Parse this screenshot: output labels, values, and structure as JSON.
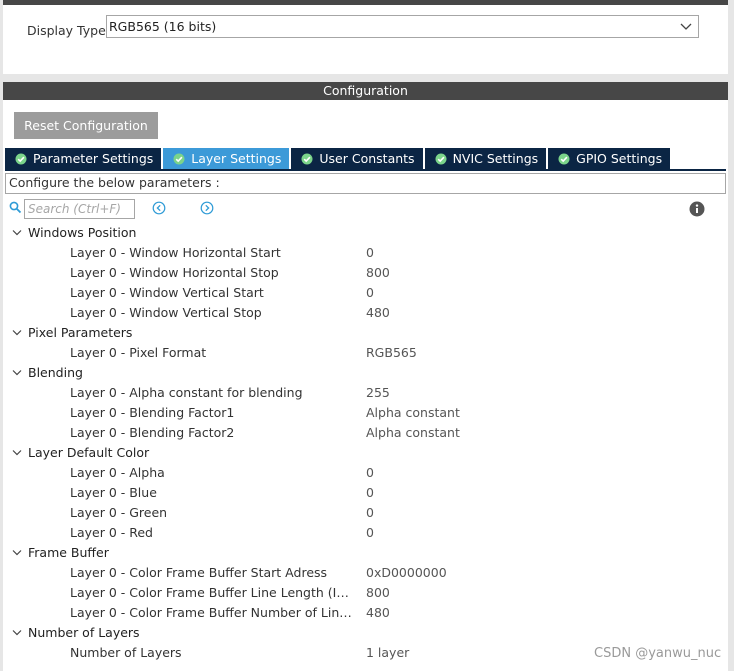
{
  "display": {
    "label": "Display Type",
    "value": "RGB565 (16 bits)"
  },
  "configuration": {
    "header": "Configuration",
    "reset_label": "Reset Configuration",
    "tabs": [
      {
        "label": "Parameter Settings",
        "active": false
      },
      {
        "label": "Layer Settings",
        "active": true
      },
      {
        "label": "User Constants",
        "active": false
      },
      {
        "label": "NVIC Settings",
        "active": false
      },
      {
        "label": "GPIO Settings",
        "active": false
      }
    ],
    "hint": "Configure the below parameters :",
    "search_placeholder": "Search (Ctrl+F)"
  },
  "groups": [
    {
      "label": "Windows Position",
      "params": [
        {
          "name": "Layer 0 - Window Horizontal Start",
          "value": "0"
        },
        {
          "name": "Layer 0 - Window Horizontal Stop",
          "value": "800"
        },
        {
          "name": "Layer 0 - Window Vertical Start",
          "value": "0"
        },
        {
          "name": "Layer 0 - Window Vertical Stop",
          "value": "480"
        }
      ]
    },
    {
      "label": "Pixel Parameters",
      "params": [
        {
          "name": "Layer 0 - Pixel Format",
          "value": "RGB565"
        }
      ]
    },
    {
      "label": "Blending",
      "params": [
        {
          "name": "Layer 0 - Alpha constant for blending",
          "value": "255"
        },
        {
          "name": "Layer 0 - Blending Factor1",
          "value": "Alpha constant"
        },
        {
          "name": "Layer 0 - Blending Factor2",
          "value": "Alpha constant"
        }
      ]
    },
    {
      "label": "Layer Default Color",
      "params": [
        {
          "name": "Layer 0 - Alpha",
          "value": "0"
        },
        {
          "name": "Layer 0 - Blue",
          "value": "0"
        },
        {
          "name": "Layer 0 - Green",
          "value": "0"
        },
        {
          "name": "Layer 0 - Red",
          "value": "0"
        }
      ]
    },
    {
      "label": "Frame Buffer",
      "params": [
        {
          "name": "Layer 0 - Color Frame Buffer Start Adress",
          "value": "0xD0000000"
        },
        {
          "name": "Layer 0 - Color Frame Buffer Line Length (Image ...",
          "value": "800"
        },
        {
          "name": "Layer 0 - Color Frame Buffer Number of Lines (I...",
          "value": "480"
        }
      ]
    },
    {
      "label": "Number of Layers",
      "params": [
        {
          "name": "Number of Layers",
          "value": "1 layer"
        }
      ]
    }
  ],
  "watermark": "CSDN @yanwu_nuc",
  "colors": {
    "header_bg": "#474747",
    "tab_bg": "#0b2544",
    "tab_active_bg": "#3c9ad8",
    "tab_check": "#7bd48a",
    "accent_blue": "#2f9bd6",
    "button_bg": "#9c9c9c"
  }
}
